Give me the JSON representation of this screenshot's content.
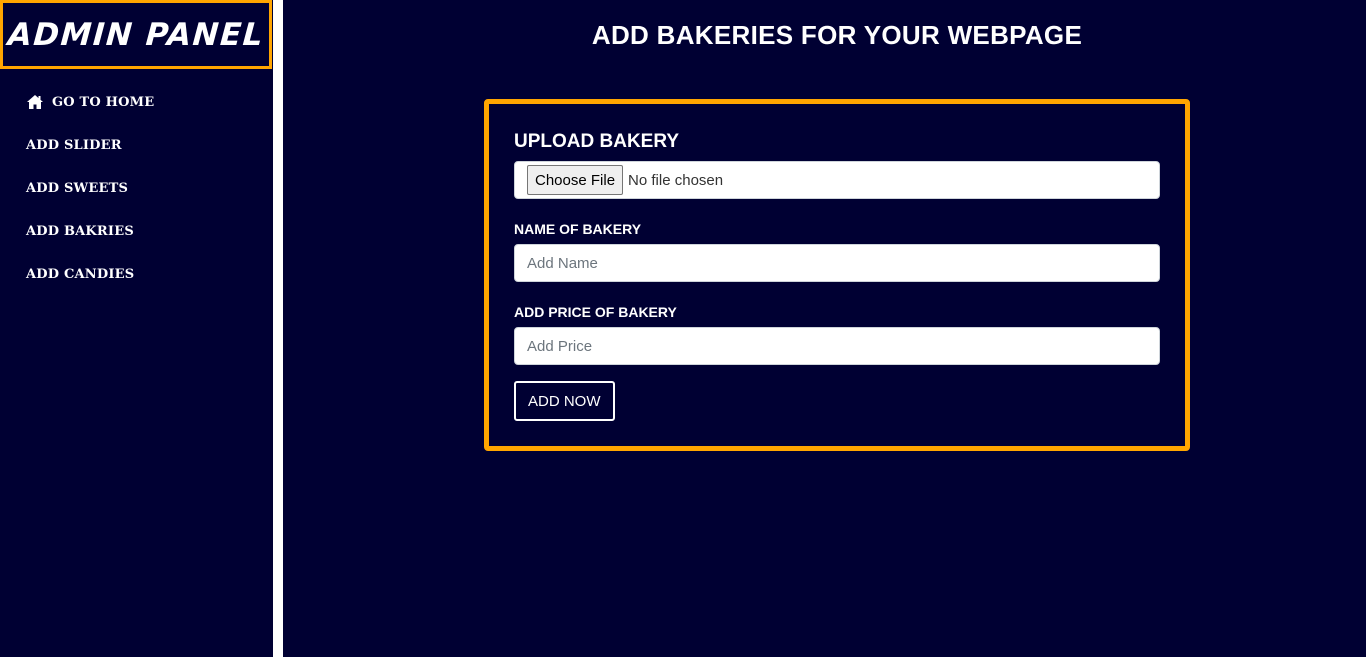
{
  "colors": {
    "background": "#000033",
    "accent": "#FFA500",
    "text": "#FFFFFF",
    "divider": "#FFFFFF"
  },
  "sidebar": {
    "brand": "ADMIN PANEL",
    "items": [
      {
        "label": "GO TO HOME",
        "icon": "home-icon"
      },
      {
        "label": "ADD SLIDER"
      },
      {
        "label": "ADD SWEETS"
      },
      {
        "label": "ADD BAKRIES"
      },
      {
        "label": "ADD CANDIES"
      }
    ]
  },
  "main": {
    "title": "ADD BAKERIES FOR YOUR WEBPAGE",
    "form": {
      "upload_title": "UPLOAD BAKERY",
      "file_button": "Choose File",
      "file_status": "No file chosen",
      "name_label": "NAME OF BAKERY",
      "name_placeholder": "Add Name",
      "name_value": "",
      "price_label": "ADD PRICE OF BAKERY",
      "price_placeholder": "Add Price",
      "price_value": "",
      "submit_label": "ADD NOW"
    }
  }
}
